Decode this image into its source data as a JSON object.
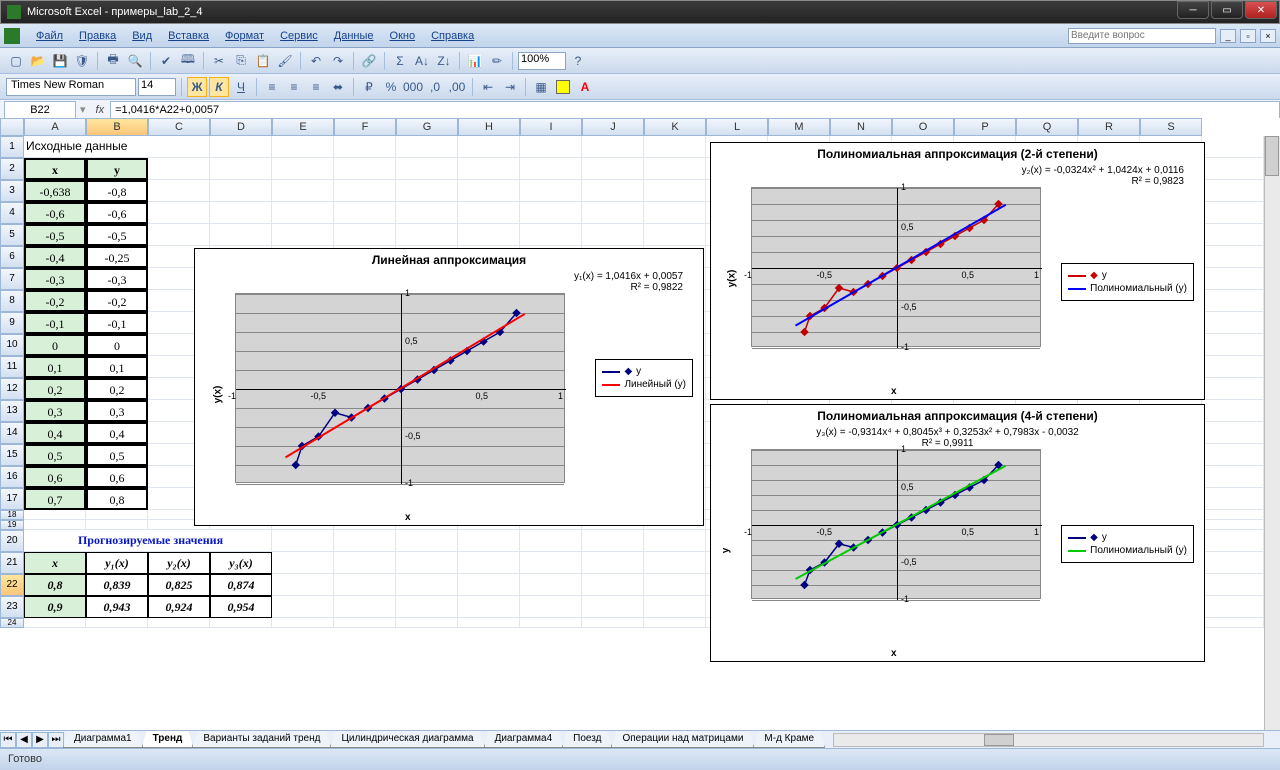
{
  "title": "Microsoft Excel - примеры_lab_2_4",
  "menu": [
    "Файл",
    "Правка",
    "Вид",
    "Вставка",
    "Формат",
    "Сервис",
    "Данные",
    "Окно",
    "Справка"
  ],
  "ask_placeholder": "Введите вопрос",
  "zoom": "100%",
  "font_name": "Times New Roman",
  "font_size": "14",
  "namebox": "B22",
  "formula": "=1,0416*A22+0,0057",
  "columns": [
    "A",
    "B",
    "C",
    "D",
    "E",
    "F",
    "G",
    "H",
    "I",
    "J",
    "K",
    "L",
    "M",
    "N",
    "O",
    "P",
    "Q",
    "R",
    "S"
  ],
  "source_title": "Исходные данные",
  "hdr_x": "x",
  "hdr_y": "y",
  "data": [
    {
      "x": "-0,638",
      "y": "-0,8"
    },
    {
      "x": "-0,6",
      "y": "-0,6"
    },
    {
      "x": "-0,5",
      "y": "-0,5"
    },
    {
      "x": "-0,4",
      "y": "-0,25"
    },
    {
      "x": "-0,3",
      "y": "-0,3"
    },
    {
      "x": "-0,2",
      "y": "-0,2"
    },
    {
      "x": "-0,1",
      "y": "-0,1"
    },
    {
      "x": "0",
      "y": "0"
    },
    {
      "x": "0,1",
      "y": "0,1"
    },
    {
      "x": "0,2",
      "y": "0,2"
    },
    {
      "x": "0,3",
      "y": "0,3"
    },
    {
      "x": "0,4",
      "y": "0,4"
    },
    {
      "x": "0,5",
      "y": "0,5"
    },
    {
      "x": "0,6",
      "y": "0,6"
    },
    {
      "x": "0,7",
      "y": "0,8"
    }
  ],
  "prog_title": "Прогнозируемые значения",
  "prog_hdr": [
    "x",
    "y₁(x)",
    "y₂(x)",
    "y₃(x)"
  ],
  "prog_rows": [
    [
      "0,8",
      "0,839",
      "0,825",
      "0,874"
    ],
    [
      "0,9",
      "0,943",
      "0,924",
      "0,954"
    ]
  ],
  "chart1": {
    "title": "Линейная аппроксимация",
    "eq1": "y₁(x) = 1,0416x + 0,0057",
    "eq2": "R² = 0,9822",
    "legend": [
      "y",
      "Линейный (y)"
    ],
    "xlabel": "x",
    "ylabel": "y(x)"
  },
  "chart2": {
    "title": "Полиномиальная аппроксимация (2-й степени)",
    "eq1": "y₂(x) = -0,0324x² + 1,0424x + 0,0116",
    "eq2": "R² = 0,9823",
    "legend": [
      "y",
      "Полиномиальный (y)"
    ],
    "xlabel": "x",
    "ylabel": "y(x)"
  },
  "chart3": {
    "title": "Полиномиальная аппроксимация  (4-й степени)",
    "eq1": "y₃(x) = -0,9314x⁴ + 0,8045x³ + 0,3253x² + 0,7983x - 0,0032",
    "eq2": "R² = 0,9911",
    "legend": [
      "y",
      "Полиномиальный (y)"
    ],
    "xlabel": "x",
    "ylabel": "y"
  },
  "chart_data": [
    {
      "type": "scatter",
      "title": "Линейная аппроксимация",
      "xlabel": "x",
      "ylabel": "y(x)",
      "xlim": [
        -1,
        1
      ],
      "ylim": [
        -1,
        1
      ],
      "series": [
        {
          "name": "y",
          "x": [
            -0.638,
            -0.6,
            -0.5,
            -0.4,
            -0.3,
            -0.2,
            -0.1,
            0,
            0.1,
            0.2,
            0.3,
            0.4,
            0.5,
            0.6,
            0.7
          ],
          "y": [
            -0.8,
            -0.6,
            -0.5,
            -0.25,
            -0.3,
            -0.2,
            -0.1,
            0,
            0.1,
            0.2,
            0.3,
            0.4,
            0.5,
            0.6,
            0.8
          ]
        },
        {
          "name": "Линейный (y)",
          "equation": "1.0416*x+0.0057"
        }
      ]
    },
    {
      "type": "scatter",
      "title": "Полиномиальная аппроксимация (2-й степени)",
      "xlabel": "x",
      "ylabel": "y(x)",
      "xlim": [
        -1,
        1
      ],
      "ylim": [
        -1,
        1
      ],
      "series": [
        {
          "name": "y",
          "x": [
            -0.638,
            -0.6,
            -0.5,
            -0.4,
            -0.3,
            -0.2,
            -0.1,
            0,
            0.1,
            0.2,
            0.3,
            0.4,
            0.5,
            0.6,
            0.7
          ],
          "y": [
            -0.8,
            -0.6,
            -0.5,
            -0.25,
            -0.3,
            -0.2,
            -0.1,
            0,
            0.1,
            0.2,
            0.3,
            0.4,
            0.5,
            0.6,
            0.8
          ]
        },
        {
          "name": "Полиномиальный (y)",
          "equation": "-0.0324*x^2+1.0424*x+0.0116"
        }
      ]
    },
    {
      "type": "scatter",
      "title": "Полиномиальная аппроксимация (4-й степени)",
      "xlabel": "x",
      "ylabel": "y",
      "xlim": [
        -1,
        1
      ],
      "ylim": [
        -1,
        1
      ],
      "series": [
        {
          "name": "y",
          "x": [
            -0.638,
            -0.6,
            -0.5,
            -0.4,
            -0.3,
            -0.2,
            -0.1,
            0,
            0.1,
            0.2,
            0.3,
            0.4,
            0.5,
            0.6,
            0.7
          ],
          "y": [
            -0.8,
            -0.6,
            -0.5,
            -0.25,
            -0.3,
            -0.2,
            -0.1,
            0,
            0.1,
            0.2,
            0.3,
            0.4,
            0.5,
            0.6,
            0.8
          ]
        },
        {
          "name": "Полиномиальный (y)",
          "equation": "-0.9314*x^4+0.8045*x^3+0.3253*x^2+0.7983*x-0.0032"
        }
      ]
    }
  ],
  "tabs": [
    "Диаграмма1",
    "Тренд",
    "Варианты заданий тренд",
    "Цилиндрическая диаграмма",
    "Диаграмма4",
    "Поезд",
    "Операции над матрицами",
    "М-д Краме"
  ],
  "active_tab": 1,
  "status": "Готово"
}
